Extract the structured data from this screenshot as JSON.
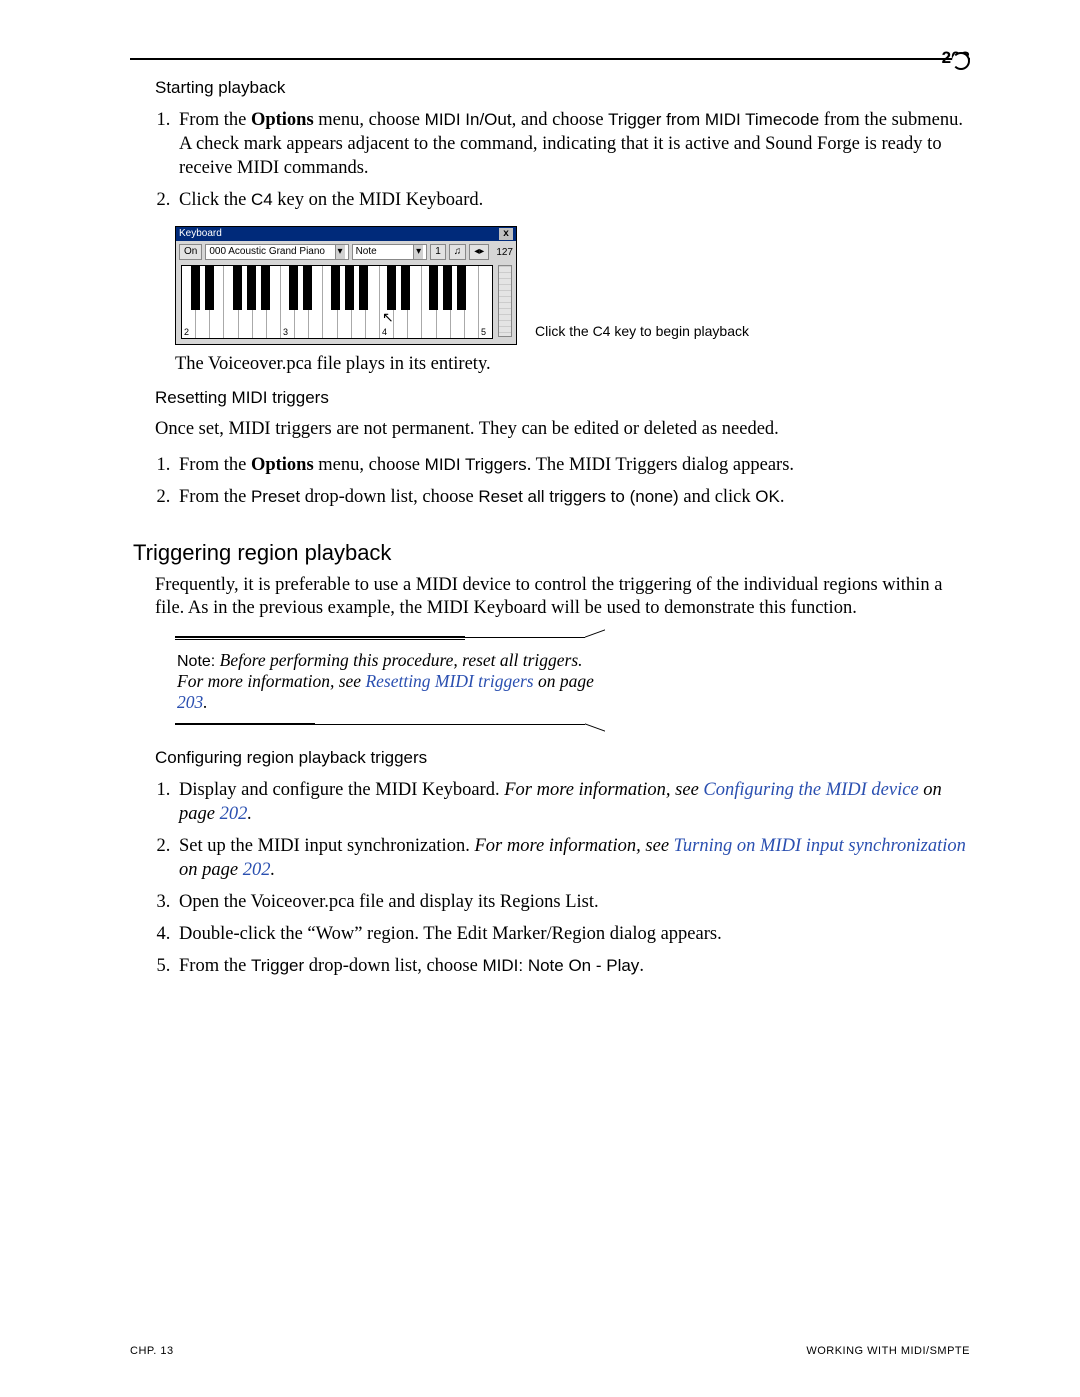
{
  "page": {
    "number": "203",
    "chapter": "CHP. 13",
    "footer_right": "WORKING WITH MIDI/SMPTE"
  },
  "sec1": {
    "heading": "Starting playback",
    "item1_a": "From the ",
    "item1_b": "Options",
    "item1_c": " menu, choose ",
    "item1_d": "MIDI In/Out",
    "item1_e": ", and choose ",
    "item1_f": "Trigger from MIDI Timecode",
    "item1_g": " from the submenu. A check mark appears adjacent to the command, indicating that it is active and Sound Forge is ready to receive MIDI commands.",
    "item2_a": "Click the ",
    "item2_b": "C4",
    "item2_c": " key on the MIDI Keyboard.",
    "caption": "Click the C4 key to begin playback",
    "after_kb": "The Voiceover.pca file plays in its entirety."
  },
  "keyboard": {
    "title": "Keyboard",
    "on": "On",
    "instrument": "000  Acoustic Grand Piano",
    "note_label": "Note",
    "chan": "1",
    "vel": "127",
    "oct2": "2",
    "oct3": "3",
    "oct4": "4",
    "oct5": "5"
  },
  "sec2": {
    "heading": "Resetting MIDI triggers",
    "intro": "Once set, MIDI triggers are not permanent. They can be edited or deleted as needed.",
    "item1_a": "From the ",
    "item1_b": "Options",
    "item1_c": " menu, choose ",
    "item1_d": "MIDI Triggers",
    "item1_e": ". The MIDI Triggers dialog appears.",
    "item2_a": "From the ",
    "item2_b": "Preset",
    "item2_c": " drop-down list, choose ",
    "item2_d": "Reset all triggers to (none)",
    "item2_e": " and click ",
    "item2_f": "OK",
    "item2_g": "."
  },
  "sec3": {
    "heading": "Triggering region playback",
    "intro": "Frequently, it is preferable to use a MIDI device to control the triggering of the individual regions within a file. As in the previous example, the MIDI Keyboard will be used to demonstrate this function."
  },
  "note": {
    "label": "Note:",
    "text_a": " Before performing this procedure, reset all triggers. For more information, see ",
    "link": "Resetting MIDI triggers",
    "text_b": " on page ",
    "page": "203",
    "text_c": "."
  },
  "sec4": {
    "heading": "Configuring region playback triggers",
    "i1_a": "Display and configure the MIDI Keyboard. ",
    "i1_b": "For more information, see ",
    "i1_link": "Configuring the MIDI device",
    "i1_c": " on page ",
    "i1_page": "202",
    "i1_d": ".",
    "i2_a": "Set up the MIDI input synchronization. ",
    "i2_b": "For more information, see ",
    "i2_link": "Turning on MIDI input synchronization",
    "i2_c": " on page ",
    "i2_page": "202",
    "i2_d": ".",
    "i3": "Open the Voiceover.pca file and display its Regions List.",
    "i4": "Double-click the “Wow” region. The Edit Marker/Region dialog appears.",
    "i5_a": "From the ",
    "i5_b": "Trigger",
    "i5_c": " drop-down list, choose ",
    "i5_d": "MIDI: Note On - Play",
    "i5_e": "."
  }
}
